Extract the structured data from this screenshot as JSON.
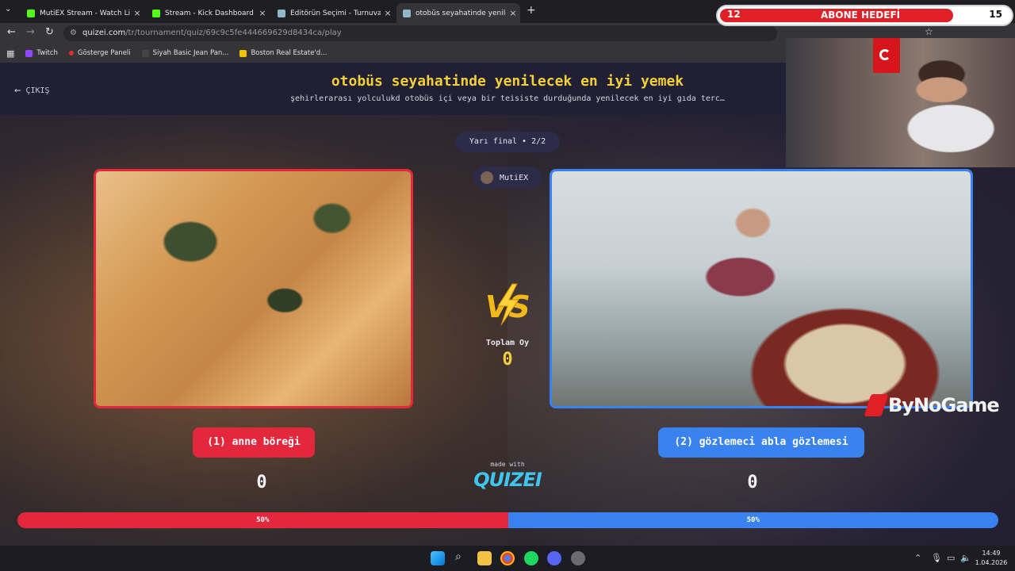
{
  "browser": {
    "tabs": [
      {
        "title": "MutiEX Stream - Watch Live on",
        "active": false,
        "icon_color": "#53fc18"
      },
      {
        "title": "Stream - Kick Dashboard",
        "active": false,
        "icon_color": "#53fc18"
      },
      {
        "title": "Editörün Seçimi - Turnuva - Qu",
        "active": false,
        "icon_color": "#8fb8c8"
      },
      {
        "title": "otobüs seyahatinde yenilecek e",
        "active": true,
        "icon_color": "#8fb8c8"
      }
    ],
    "url_host": "quizei.com",
    "url_path": "/tr/tournament/quiz/69c9c5fe444669629d8434ca/play",
    "bookmarks": [
      {
        "label": "Twitch",
        "icon_color": "#9146ff"
      },
      {
        "label": "Gösterge Paneli",
        "icon_color": "#e02c2c"
      },
      {
        "label": "Siyah Basic Jean Pan...",
        "icon_color": "#444444"
      },
      {
        "label": "Boston Real Estate'd...",
        "icon_color": "#f2c200"
      }
    ]
  },
  "quiz": {
    "exit_label": "ÇIKIŞ",
    "title": "otobüs seyahatinde yenilecek en iyi yemek",
    "subtitle": "şehirlerarası yolculukd otobüs içi veya bir teisiste durduğunda yenilecek en iyi gıda terc…",
    "round_label": "Yarı final • 2/2",
    "user_name": "MutiEX",
    "vs_label": "VS",
    "total_votes_label": "Toplam Oy",
    "total_votes": "0",
    "left": {
      "label": "(1) anne böreği",
      "votes": "0",
      "percent_label": "50%",
      "percent": 50
    },
    "right": {
      "label": "(2) gözlemeci abla gözlemesi",
      "votes": "0",
      "percent_label": "50%",
      "percent": 50
    },
    "made_with": "made with",
    "brand": "QUIZEI",
    "colors": {
      "left": "#e3283e",
      "right": "#3a82f0",
      "title": "#f3cf3a"
    }
  },
  "overlay": {
    "goal_current": "12",
    "goal_label": "ABONE HEDEFİ",
    "goal_target": "15",
    "goal_progress": 0.8,
    "watermark": "ByNoGame"
  },
  "taskbar": {
    "time": "14:49",
    "date": "1.04.2026"
  }
}
